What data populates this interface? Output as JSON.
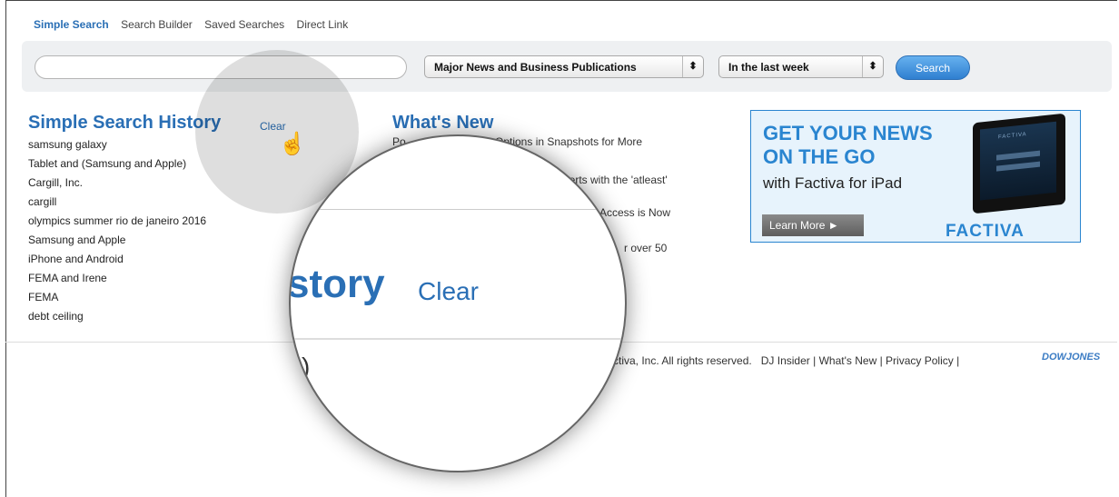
{
  "topnav": {
    "simple_search": "Simple Search",
    "search_builder": "Search Builder",
    "saved_searches": "Saved Searches",
    "direct_link": "Direct Link"
  },
  "search": {
    "query_value": "",
    "source_select": "Major News and Business Publications",
    "date_select": "In the last week",
    "button_label": "Search"
  },
  "history": {
    "title": "Simple Search History",
    "clear_label": "Clear",
    "items": [
      "samsung galaxy",
      "Tablet and (Samsung and Apple)",
      "Cargill, Inc.",
      "cargill",
      "olympics summer rio de janeiro 2016",
      "Samsung and Apple",
      "iPhone and Android",
      "FEMA and Irene",
      "FEMA",
      "debt ceiling"
    ]
  },
  "whats_new": {
    "title": "What's New",
    "items": [
      "Po",
      "Options in Snapshots for More",
      "lerts with the 'atleast'",
      "Access is Now",
      "r over 50"
    ]
  },
  "ad": {
    "headline_1": "GET YOUR NEWS",
    "headline_2": "ON THE GO",
    "subline": "with Factiva for iPad",
    "button_label": "Learn More ►",
    "brand": "FACTIVA",
    "ipad_label": "FACTIVA"
  },
  "footer": {
    "copyright": "ctiva, Inc. All rights reserved.",
    "links": [
      "DJ Insider",
      "What's New",
      "Privacy Policy"
    ],
    "dj_logo": "DOWJONES"
  },
  "magnifier": {
    "history_fragment": "story",
    "clear_label": "Clear",
    "paren": ")"
  }
}
